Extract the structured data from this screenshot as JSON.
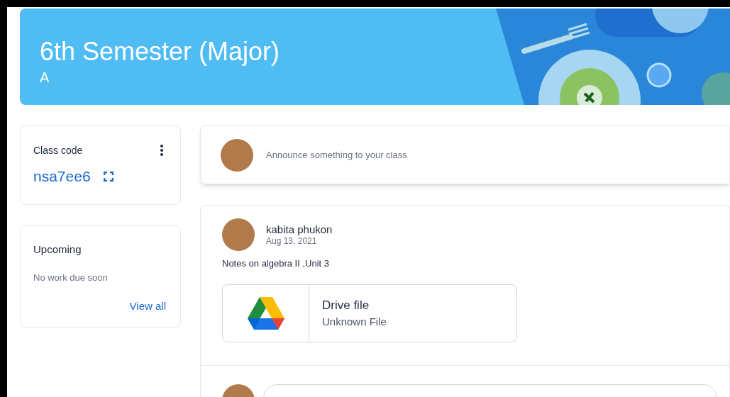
{
  "banner": {
    "title": "6th Semester (Major)",
    "section": "A"
  },
  "class_code": {
    "label": "Class code",
    "code": "nsa7ee6"
  },
  "upcoming": {
    "title": "Upcoming",
    "message": "No work due soon",
    "link": "View all"
  },
  "announce": {
    "placeholder": "Announce something to your class"
  },
  "post": {
    "author": "kabita phukon",
    "date": "Aug 13, 2021",
    "text": "Notes on algebra II ,Unit 3",
    "attachment": {
      "title": "Drive file",
      "subtitle": "Unknown File"
    }
  }
}
